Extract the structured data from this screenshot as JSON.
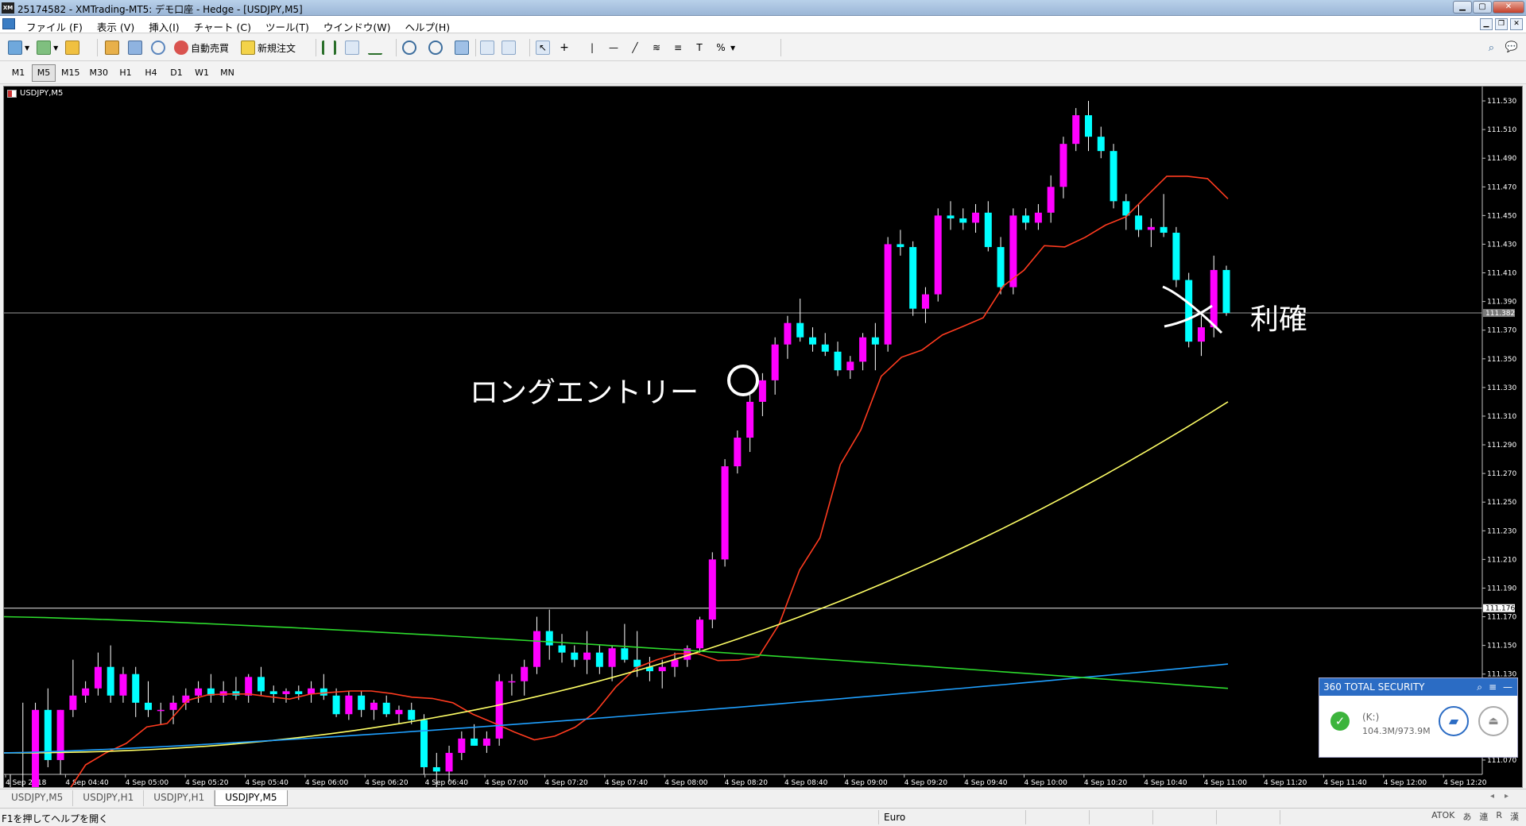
{
  "window": {
    "title": "25174582 - XMTrading-MT5: デモ口座 - Hedge - [USDJPY,M5]",
    "app_badge": "XM"
  },
  "menu": [
    "ファイル (F)",
    "表示 (V)",
    "挿入(I)",
    "チャート (C)",
    "ツール(T)",
    "ウインドウ(W)",
    "ヘルプ(H)"
  ],
  "toolbar": {
    "auto_trade_label": "自動売買",
    "new_order_label": "新規注文"
  },
  "timeframes": [
    "M1",
    "M5",
    "M15",
    "M30",
    "H1",
    "H4",
    "D1",
    "W1",
    "MN"
  ],
  "active_timeframe": "M5",
  "chart": {
    "symbol_label": "USDJPY,M5",
    "bid_line_label": "111.382",
    "hline_label": "111.176",
    "annotation_entry": "ロングエントリー",
    "annotation_exit": "利確"
  },
  "chart_data": {
    "type": "candlestick",
    "symbol": "USDJPY",
    "timeframe": "M5",
    "ylim": [
      111.06,
      111.54
    ],
    "y_ticks": [
      111.53,
      111.51,
      111.49,
      111.47,
      111.45,
      111.43,
      111.41,
      111.39,
      111.37,
      111.35,
      111.33,
      111.31,
      111.29,
      111.27,
      111.25,
      111.23,
      111.21,
      111.19,
      111.17,
      111.15,
      111.13,
      111.11,
      111.09,
      111.07
    ],
    "x_tick_labels": [
      "4 Sep 2018",
      "4 Sep 04:40",
      "4 Sep 05:00",
      "4 Sep 05:20",
      "4 Sep 05:40",
      "4 Sep 06:00",
      "4 Sep 06:20",
      "4 Sep 06:40",
      "4 Sep 07:00",
      "4 Sep 07:20",
      "4 Sep 07:40",
      "4 Sep 08:00",
      "4 Sep 08:20",
      "4 Sep 08:40",
      "4 Sep 09:00",
      "4 Sep 09:20",
      "4 Sep 09:40",
      "4 Sep 10:00",
      "4 Sep 10:20",
      "4 Sep 10:40",
      "4 Sep 11:00",
      "4 Sep 11:20",
      "4 Sep 11:40",
      "4 Sep 12:00",
      "4 Sep 12:20"
    ],
    "horizontal_lines": [
      111.382,
      111.176
    ],
    "bull_color": "#ff00ff",
    "bear_color": "#00ffff",
    "candles_ohlc": [
      [
        111.045,
        111.06,
        111.03,
        111.045
      ],
      [
        111.045,
        111.11,
        111.03,
        111.05
      ],
      [
        111.05,
        111.11,
        111.04,
        111.105
      ],
      [
        111.105,
        111.12,
        111.065,
        111.07
      ],
      [
        111.07,
        111.105,
        111.06,
        111.105
      ],
      [
        111.105,
        111.14,
        111.1,
        111.115
      ],
      [
        111.115,
        111.125,
        111.11,
        111.12
      ],
      [
        111.12,
        111.145,
        111.115,
        111.135
      ],
      [
        111.135,
        111.15,
        111.11,
        111.115
      ],
      [
        111.115,
        111.135,
        111.11,
        111.13
      ],
      [
        111.13,
        111.135,
        111.1,
        111.11
      ],
      [
        111.11,
        111.125,
        111.1,
        111.105
      ],
      [
        111.105,
        111.11,
        111.095,
        111.105
      ],
      [
        111.105,
        111.115,
        111.095,
        111.11
      ],
      [
        111.11,
        111.12,
        111.105,
        111.115
      ],
      [
        111.115,
        111.125,
        111.11,
        111.12
      ],
      [
        111.12,
        111.13,
        111.11,
        111.115
      ],
      [
        111.115,
        111.125,
        111.11,
        111.118
      ],
      [
        111.118,
        111.128,
        111.112,
        111.115
      ],
      [
        111.115,
        111.13,
        111.11,
        111.128
      ],
      [
        111.128,
        111.135,
        111.115,
        111.118
      ],
      [
        111.118,
        111.122,
        111.11,
        111.116
      ],
      [
        111.116,
        111.12,
        111.11,
        111.118
      ],
      [
        111.118,
        111.122,
        111.112,
        111.116
      ],
      [
        111.116,
        111.125,
        111.11,
        111.12
      ],
      [
        111.12,
        111.13,
        111.112,
        111.115
      ],
      [
        111.115,
        111.12,
        111.1,
        111.102
      ],
      [
        111.102,
        111.118,
        111.098,
        111.115
      ],
      [
        111.115,
        111.118,
        111.1,
        111.105
      ],
      [
        111.105,
        111.112,
        111.098,
        111.11
      ],
      [
        111.11,
        111.115,
        111.1,
        111.102
      ],
      [
        111.102,
        111.108,
        111.095,
        111.105
      ],
      [
        111.105,
        111.11,
        111.095,
        111.098
      ],
      [
        111.098,
        111.102,
        111.06,
        111.065
      ],
      [
        111.065,
        111.075,
        111.05,
        111.062
      ],
      [
        111.062,
        111.08,
        111.055,
        111.075
      ],
      [
        111.075,
        111.09,
        111.07,
        111.085
      ],
      [
        111.085,
        111.095,
        111.08,
        111.08
      ],
      [
        111.08,
        111.09,
        111.075,
        111.085
      ],
      [
        111.085,
        111.13,
        111.08,
        111.125
      ],
      [
        111.125,
        111.13,
        111.115,
        111.125
      ],
      [
        111.125,
        111.14,
        111.115,
        111.135
      ],
      [
        111.135,
        111.17,
        111.13,
        111.16
      ],
      [
        111.16,
        111.175,
        111.14,
        111.15
      ],
      [
        111.15,
        111.158,
        111.138,
        111.145
      ],
      [
        111.145,
        111.15,
        111.135,
        111.14
      ],
      [
        111.14,
        111.16,
        111.13,
        111.145
      ],
      [
        111.145,
        111.15,
        111.13,
        111.135
      ],
      [
        111.135,
        111.15,
        111.125,
        111.148
      ],
      [
        111.148,
        111.165,
        111.138,
        111.14
      ],
      [
        111.14,
        111.16,
        111.128,
        111.135
      ],
      [
        111.135,
        111.142,
        111.125,
        111.132
      ],
      [
        111.132,
        111.14,
        111.12,
        111.135
      ],
      [
        111.135,
        111.145,
        111.128,
        111.14
      ],
      [
        111.14,
        111.15,
        111.135,
        111.148
      ],
      [
        111.148,
        111.17,
        111.145,
        111.168
      ],
      [
        111.168,
        111.215,
        111.162,
        111.21
      ],
      [
        111.21,
        111.28,
        111.205,
        111.275
      ],
      [
        111.275,
        111.3,
        111.27,
        111.295
      ],
      [
        111.295,
        111.325,
        111.285,
        111.32
      ],
      [
        111.32,
        111.34,
        111.31,
        111.335
      ],
      [
        111.335,
        111.365,
        111.325,
        111.36
      ],
      [
        111.36,
        111.38,
        111.35,
        111.375
      ],
      [
        111.375,
        111.392,
        111.362,
        111.365
      ],
      [
        111.365,
        111.372,
        111.355,
        111.36
      ],
      [
        111.36,
        111.368,
        111.352,
        111.355
      ],
      [
        111.355,
        111.362,
        111.338,
        111.342
      ],
      [
        111.342,
        111.352,
        111.336,
        111.348
      ],
      [
        111.348,
        111.368,
        111.342,
        111.365
      ],
      [
        111.365,
        111.375,
        111.342,
        111.36
      ],
      [
        111.36,
        111.435,
        111.355,
        111.43
      ],
      [
        111.43,
        111.44,
        111.422,
        111.428
      ],
      [
        111.428,
        111.432,
        111.38,
        111.385
      ],
      [
        111.385,
        111.4,
        111.375,
        111.395
      ],
      [
        111.395,
        111.455,
        111.39,
        111.45
      ],
      [
        111.45,
        111.46,
        111.44,
        111.448
      ],
      [
        111.448,
        111.455,
        111.44,
        111.445
      ],
      [
        111.445,
        111.458,
        111.438,
        111.452
      ],
      [
        111.452,
        111.46,
        111.425,
        111.428
      ],
      [
        111.428,
        111.435,
        111.395,
        111.4
      ],
      [
        111.4,
        111.455,
        111.395,
        111.45
      ],
      [
        111.45,
        111.455,
        111.44,
        111.445
      ],
      [
        111.445,
        111.458,
        111.44,
        111.452
      ],
      [
        111.452,
        111.478,
        111.445,
        111.47
      ],
      [
        111.47,
        111.505,
        111.462,
        111.5
      ],
      [
        111.5,
        111.525,
        111.495,
        111.52
      ],
      [
        111.52,
        111.53,
        111.495,
        111.505
      ],
      [
        111.505,
        111.512,
        111.49,
        111.495
      ],
      [
        111.495,
        111.5,
        111.455,
        111.46
      ],
      [
        111.46,
        111.465,
        111.44,
        111.45
      ],
      [
        111.45,
        111.458,
        111.435,
        111.44
      ],
      [
        111.44,
        111.448,
        111.428,
        111.442
      ],
      [
        111.442,
        111.465,
        111.435,
        111.438
      ],
      [
        111.438,
        111.442,
        111.4,
        111.405
      ],
      [
        111.405,
        111.41,
        111.358,
        111.362
      ],
      [
        111.362,
        111.38,
        111.352,
        111.372
      ],
      [
        111.372,
        111.422,
        111.365,
        111.412
      ],
      [
        111.412,
        111.415,
        111.38,
        111.382
      ]
    ],
    "ma_lines": [
      {
        "color": "#ff3b1f",
        "start": 111.03,
        "end": 111.44
      },
      {
        "color": "#ffff66",
        "start": 111.075,
        "end": 111.32
      },
      {
        "color": "#1fa0ff",
        "start": 111.075,
        "end": 111.137
      },
      {
        "color": "#2ddb2d",
        "start": 111.17,
        "end": 111.12
      }
    ]
  },
  "tabs": [
    "USDJPY,M5",
    "USDJPY,H1",
    "USDJPY,H1",
    "USDJPY,M5"
  ],
  "active_tab": 3,
  "security_widget": {
    "title": "360 TOTAL SECURITY",
    "drive": "(K:)",
    "size": "104.3M/973.9M"
  },
  "status": {
    "help_text": "F1を押してヘルプを開く",
    "profile": "Euro",
    "ime": [
      "ATOK",
      "あ",
      "連",
      "R",
      "漢"
    ]
  },
  "colors": {
    "chart_bg": "#000000",
    "window_title_bg": "#b9d1ea",
    "security_header": "#2b6cc4"
  }
}
